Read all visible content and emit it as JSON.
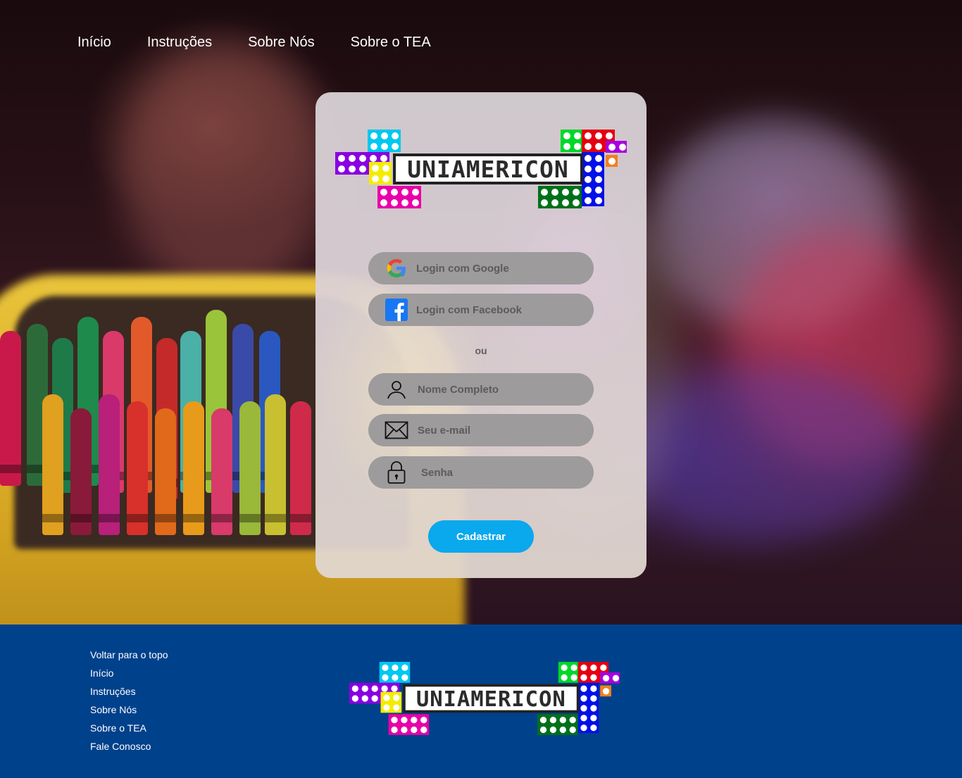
{
  "nav": {
    "items": [
      {
        "label": "Início"
      },
      {
        "label": "Instruções"
      },
      {
        "label": "Sobre Nós"
      },
      {
        "label": "Sobre o TEA"
      }
    ]
  },
  "logo": {
    "text": "UNIAMERICON"
  },
  "social": {
    "google_label": "Login com Google",
    "facebook_label": "Login com Facebook"
  },
  "divider_text": "ou",
  "form": {
    "name_placeholder": "Nome Completo",
    "email_placeholder": "Seu e-mail",
    "password_placeholder": "Senha",
    "submit_label": "Cadastrar"
  },
  "footer": {
    "links": [
      {
        "label": "Voltar para o topo"
      },
      {
        "label": "Início"
      },
      {
        "label": "Instruções"
      },
      {
        "label": "Sobre Nós"
      },
      {
        "label": "Sobre o TEA"
      },
      {
        "label": "Fale Conosco"
      }
    ]
  },
  "colors": {
    "footer_bg": "#00418c",
    "button_accent": "#0aa8ec",
    "pill_bg": "#9d9b9c"
  }
}
